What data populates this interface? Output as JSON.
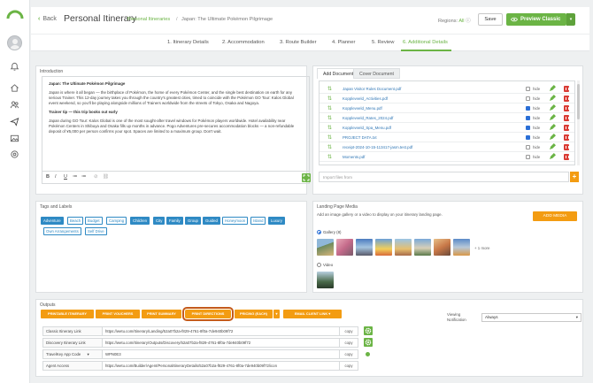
{
  "header": {
    "back_label": "Back",
    "title": "Personal Itinerary",
    "breadcrumb_section": "Personal Itineraries",
    "breadcrumb_sep": "/",
    "breadcrumb_current": "Japan: The Ultimate Pokémon Pilgrimage",
    "regions_label": "Regions:",
    "regions_value": "All",
    "save_label": "Save",
    "preview_label": "Preview Classic",
    "accent_color": "#6bb445"
  },
  "steps": [
    {
      "label": "1. Itinerary Details",
      "active": false
    },
    {
      "label": "2. Accommodation",
      "active": false
    },
    {
      "label": "3. Route Builder",
      "active": false
    },
    {
      "label": "4. Planner",
      "active": false
    },
    {
      "label": "5. Review",
      "active": false
    },
    {
      "label": "6. Additional Details",
      "active": true
    }
  ],
  "introduction": {
    "title": "Introduction",
    "heading": "Japan: The Ultimate Pokémon Pilgrimage",
    "para1": "Japan is where it all began — the birthplace of Pokémon, the home of every Pokémon Center, and the single best destination on earth for any serious Trainer. This 12-day journey takes you through the country's greatest cities, timed to coincide with the Pokémon GO Tour: Kalos Global event weekend, so you'll be playing alongside millions of Trainers worldwide from the streets of Tokyo, Osaka and Nagoya.",
    "subheading": "Trainer tip — this trip books out early",
    "para2": "Japan during GO Tour: Kalos Global is one of the most sought-after travel windows for Pokémon players worldwide. Hotel availability near Pokémon Centers in Shibuya and Osaka fills up months in advance. Pogo Adventures pre-secures accommodation blocks — a non-refundable deposit of ¥5,000 per person confirms your spot. Spaces are limited to a maximum group. Don't wait.",
    "toolbar": [
      "B",
      "I",
      "U",
      "≔",
      "≔",
      "⊘",
      "⛓"
    ]
  },
  "documents": {
    "tab_add": "Add Documents",
    "tab_cover": "Cover Document",
    "hide_label": "hide",
    "items": [
      {
        "name": "Japan Visitor Rules Document.pdf",
        "hidden": false
      },
      {
        "name": "Kopplevveld_Activities.pdf",
        "hidden": false
      },
      {
        "name": "Kopplevveld_Menu.pdf",
        "hidden": true
      },
      {
        "name": "Kopplevveld_Rates_2024.pdf",
        "hidden": true
      },
      {
        "name": "Kopplevveld_Spa_Menu.pdf",
        "hidden": true
      },
      {
        "name": "PROJECT DATA.txt",
        "hidden": true
      },
      {
        "name": "receipt-2024-10-15-113417-jasm.test.pdf",
        "hidden": false
      },
      {
        "name": "Moments.pdf",
        "hidden": false
      }
    ],
    "import_placeholder": "Import files from",
    "import_add": "+"
  },
  "tags": {
    "title": "Tags and Labels",
    "items": [
      {
        "label": "Adventure",
        "on": true
      },
      {
        "label": "Beach",
        "on": false
      },
      {
        "label": "Budget",
        "on": false
      },
      {
        "label": "Camping",
        "on": false
      },
      {
        "label": "Children",
        "on": true
      },
      {
        "label": "City",
        "on": true
      },
      {
        "label": "Family",
        "on": true
      },
      {
        "label": "Group",
        "on": true
      },
      {
        "label": "Guided",
        "on": true
      },
      {
        "label": "Honeymoon",
        "on": false
      },
      {
        "label": "Island",
        "on": false
      },
      {
        "label": "Luxury",
        "on": true
      },
      {
        "label": "Own Arrangements",
        "on": false
      },
      {
        "label": "Self Drive",
        "on": false
      }
    ]
  },
  "landing_media": {
    "title": "Landing Page Media",
    "description": "Add an image gallery or a video to display on your itinerary landing page.",
    "add_media": "ADD MEDIA",
    "gallery_label": "Gallery (8)",
    "more_label": "+ 1 more",
    "video_label": "Video"
  },
  "outputs": {
    "title": "Outputs",
    "buttons": [
      {
        "label": "PRINTABLE ITINERARY",
        "highlight": false
      },
      {
        "label": "PRINT VOUCHERS",
        "highlight": false
      },
      {
        "label": "PRINT SUMMARY",
        "highlight": false
      },
      {
        "label": "PRINT DIRECTIONS",
        "highlight": true
      },
      {
        "label": "PRICING (EACH)",
        "highlight": false
      },
      {
        "label": "EMAIL CLIENT LINK",
        "highlight": false
      }
    ],
    "rows": [
      {
        "label": "Classic Itinerary Link",
        "value": "https://wetu.com/Itinerary/Landing/52a07b2a-f829-4761-8f0a-7de940b09f72",
        "copy": "copy"
      },
      {
        "label": "Discovery Itinerary Link",
        "value": "https://wetu.com/Itinerary/Outputs/Discovery/52a07b2a-f829-4761-8f0a-7de940b09f72",
        "copy": "copy"
      },
      {
        "label": "TravelKey App Code",
        "value": "WPN0E3",
        "copy": "copy"
      },
      {
        "label": "Agent Access",
        "value": "https://wetu.com/Builder/Agent/PersonalItineraryDetails/52a07b2a-f829-4761-8f0a-7de940b09f72/icon",
        "copy": "copy"
      }
    ],
    "viewing_label": "Viewing Notification",
    "viewing_value": "Always"
  }
}
